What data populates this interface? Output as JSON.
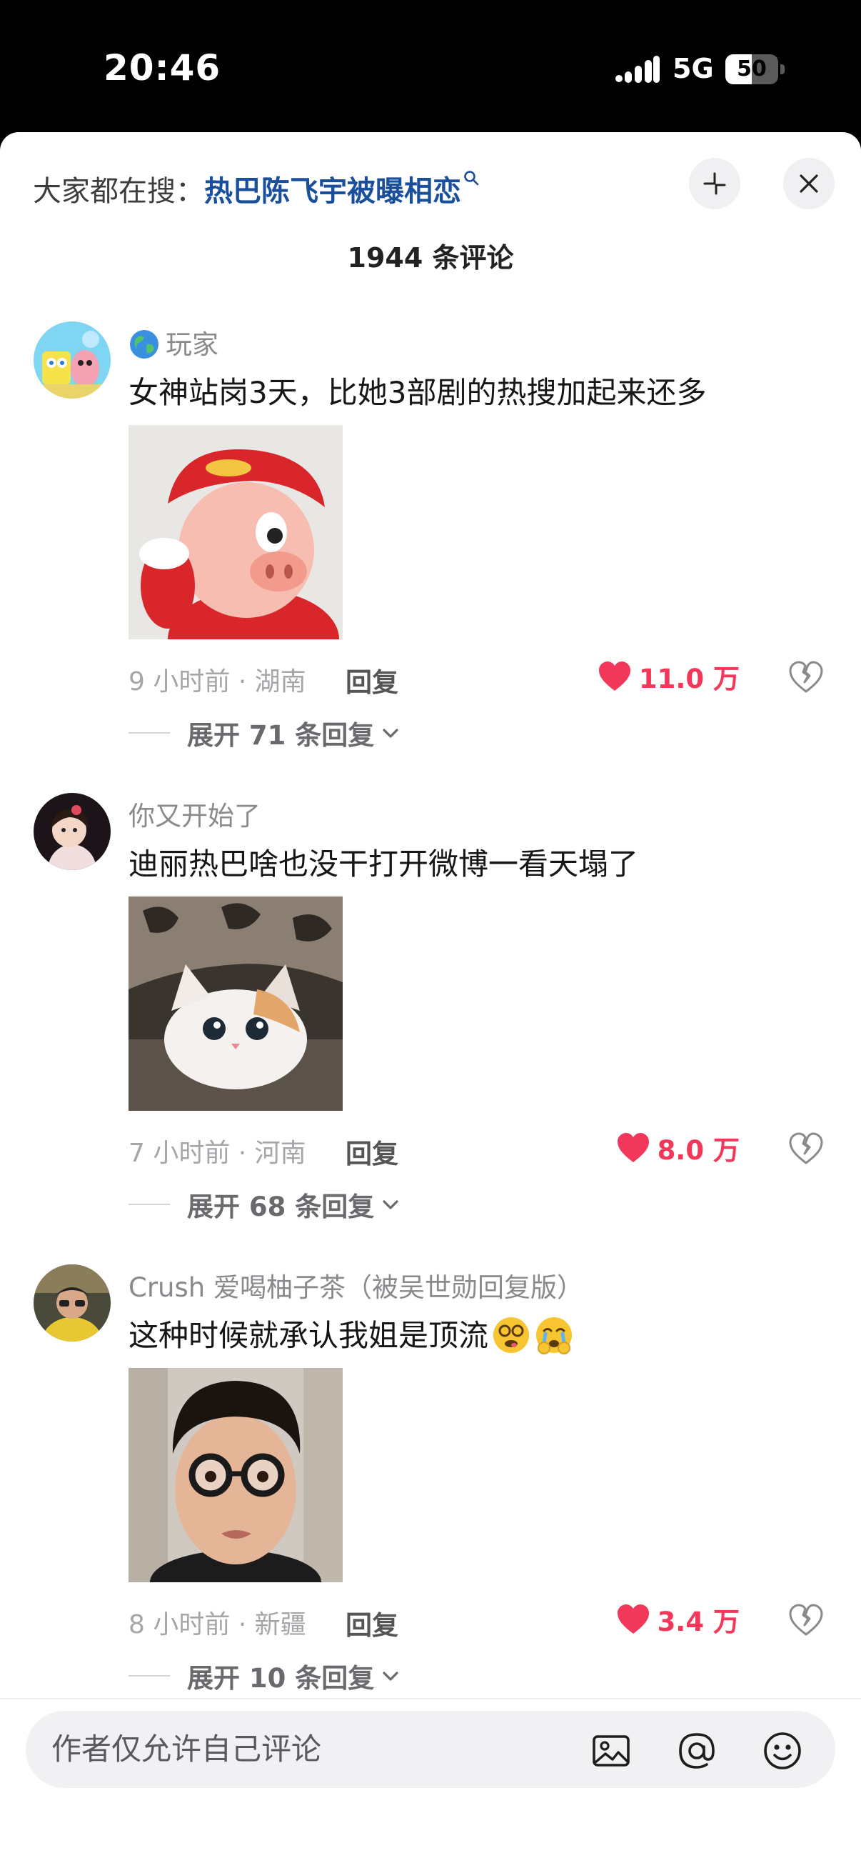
{
  "status_bar": {
    "time": "20:46",
    "network": "5G",
    "battery": "50",
    "battery_level": 0.5
  },
  "header": {
    "search_prefix": "大家都在搜：",
    "search_term": "热巴陈飞宇被曝相恋",
    "comment_count": "1944 条评论"
  },
  "comments": [
    {
      "username": "玩家",
      "text": "女神站岗3天，比她3部剧的热搜加起来还多",
      "time_location": "9 小时前 · 湖南",
      "reply_label": "回复",
      "likes": "11.0 万",
      "expand_label": "展开 71 条回复"
    },
    {
      "username": "你又开始了",
      "text": "迪丽热巴啥也没干打开微博一看天塌了",
      "time_location": "7 小时前 · 河南",
      "reply_label": "回复",
      "likes": "8.0 万",
      "expand_label": "展开 68 条回复"
    },
    {
      "username": "Crush 爱喝柚子茶（被吴世勋回复版）",
      "text": "这种时候就承认我姐是顶流",
      "time_location": "8 小时前 · 新疆",
      "reply_label": "回复",
      "likes": "3.4 万",
      "expand_label": "展开 10 条回复"
    }
  ],
  "input_bar": {
    "placeholder": "作者仅允许自己评论"
  },
  "icons": {
    "search": "magnifier-icon",
    "collapse": "collapse-icon",
    "close": "close-icon",
    "like": "heart-icon",
    "dislike": "broken-heart-icon",
    "expand": "chevron-down-icon",
    "image": "image-icon",
    "mention": "at-icon",
    "emoji": "smiley-icon"
  },
  "colors": {
    "accent_like": "#f2385a",
    "search_term": "#1a4f9c",
    "meta_gray": "#a6a6aa"
  }
}
